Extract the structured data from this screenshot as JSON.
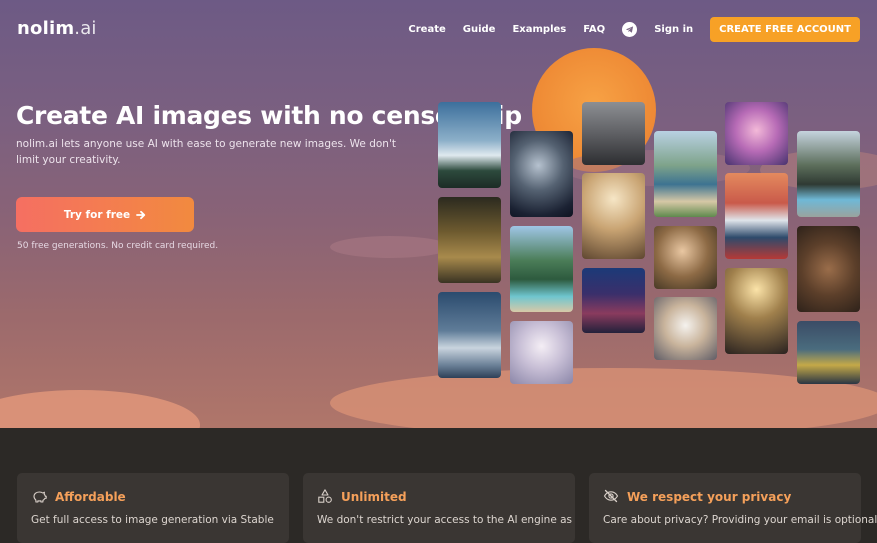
{
  "brand": {
    "name": "nolim",
    "suffix": ".ai"
  },
  "nav": {
    "items": [
      "Create",
      "Guide",
      "Examples",
      "FAQ"
    ],
    "telegram_icon": "telegram-icon",
    "sign_in": "Sign in",
    "cta": "CREATE FREE ACCOUNT"
  },
  "hero": {
    "title": "Create AI images with no censorship",
    "subtitle": "nolim.ai lets anyone use AI with ease to generate new images. We don't limit your creativity.",
    "button_label": "Try for free",
    "button_icon": "arrow-right-icon",
    "note": "50 free generations. No credit card required."
  },
  "gallery": [
    "mountain-lake-moon",
    "ai-robot-woman",
    "suited-man-city",
    "palace-hall",
    "mountain-lake-lodge",
    "monkey-family",
    "tropical-resort",
    "cyberpunk-bearded-man",
    "ornate-lobby",
    "snow-mountain-moon",
    "white-hair-woman",
    "renaissance-woman",
    "puppy-bunny-hat",
    "anime-girl-colorful",
    "red-alpine-sunset",
    "chandelier-hall",
    "modern-glass-house",
    "monkey-group",
    "neon-city-rain"
  ],
  "features": [
    {
      "icon": "piggy-bank-icon",
      "title": "Affordable",
      "text": "Get full access to image generation via Stable"
    },
    {
      "icon": "shapes-icon",
      "title": "Unlimited",
      "text": "We don't restrict your access to the AI engine as"
    },
    {
      "icon": "eye-slash-icon",
      "title": "We respect your privacy",
      "text": "Care about privacy? Providing your email is optional"
    }
  ],
  "colors": {
    "accent": "#f7a126",
    "gradient_start": "#f56f62",
    "gradient_end": "#f28a3f",
    "feature_title": "#f5a05a"
  }
}
